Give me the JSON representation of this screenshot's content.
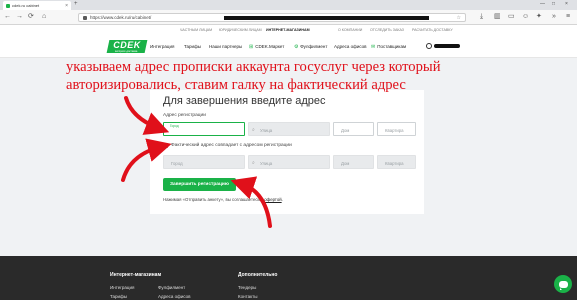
{
  "browser": {
    "tab_title": "cdek.ru cabinet",
    "tab_close": "×",
    "new_tab": "+",
    "url": "https://www.cdek.ru/ru/cabinet/",
    "window_controls": [
      "—",
      "□",
      "×"
    ],
    "nav": {
      "back": "←",
      "forward": "→",
      "reload": "⟳",
      "home": "⌂",
      "menu": "≡"
    }
  },
  "site": {
    "top_links": [
      "ЧАСТНЫМ ЛИЦАМ",
      "ЮРИДИЧЕСКИМ ЛИЦАМ",
      "ИНТЕРНЕТ-МАГАЗИНАМ",
      "О КОМПАНИИ",
      "ОТСЛЕДИТЬ ЗАКАЗ",
      "РАСЧИТАТЬ ДОСТАВКУ"
    ],
    "logo": {
      "text": "CDEK",
      "subtitle": "экспресс-доставка"
    },
    "menu": [
      "Интеграция",
      "Тарифы",
      "Наши партнеры",
      "CDEK.Маркет",
      "Фулфилмент",
      "Адреса офисов",
      "Поставщикам"
    ]
  },
  "annotation": {
    "lines": [
      "указываем адрес прописки аккаунта госуслуг через который",
      "авторизировались, ставим галку на фактический адрес"
    ],
    "color": "#e0101a"
  },
  "form": {
    "title": "Для завершения введите адрес",
    "registration_label": "Адрес регистрации",
    "reg_city_label": "Город",
    "reg_street_placeholder": "Улица",
    "reg_house_placeholder": "Дом",
    "reg_flat_placeholder": "Квартира",
    "checkbox_label": "Фактический адрес совпадает с адресом регистрации",
    "fact_city_placeholder": "Город",
    "fact_street_placeholder": "Улица",
    "fact_house_placeholder": "Дом",
    "fact_flat_placeholder": "Квартира",
    "submit_label": "Завершить регистрацию",
    "consent_text": "Нажимая «Отправить анкету», вы соглашаетесь с",
    "consent_link": "офертой",
    "consent_end": "."
  },
  "footer": {
    "col1_title": "Интернет-магазинам",
    "col1_links": [
      "Интеграция",
      "Тарифы"
    ],
    "col1b_links": [
      "Фулфилмент",
      "Адреса офисов"
    ],
    "col2_title": "Дополнительно",
    "col2_links": [
      "Тендеры",
      "Контакты"
    ]
  },
  "colors": {
    "brand_green": "#1ab248",
    "arrow_red": "#e0101a",
    "footer_bg": "#2a2a2a"
  }
}
